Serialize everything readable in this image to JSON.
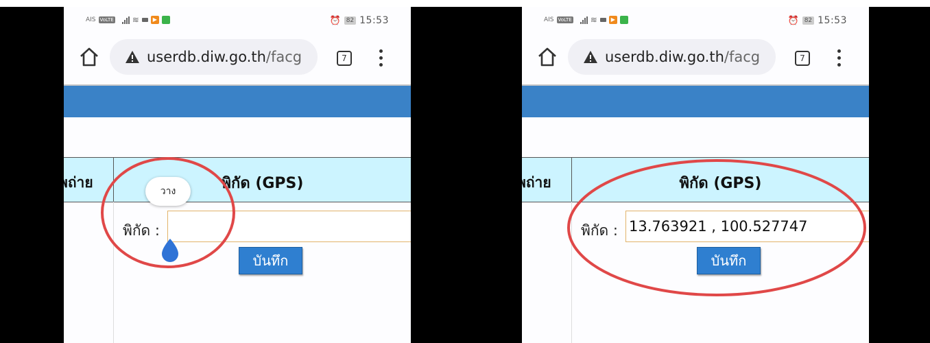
{
  "statusbar": {
    "carrier": "AIS",
    "volte": "VoLTE",
    "battery": "82",
    "time": "15:53"
  },
  "browser": {
    "url_main": "userdb.diw.go.th",
    "url_rest": "/facg",
    "tab_count": "7"
  },
  "table": {
    "col_left_header": "พถ่าย",
    "col_main_header": "พิกัด (GPS)"
  },
  "form": {
    "coord_label": "พิกัด :",
    "left_input_value": "",
    "right_input_value": "13.763921 , 100.527747",
    "save_label": "บันทึก"
  },
  "context_menu": {
    "paste_label": "วาง"
  },
  "colors": {
    "header_band": "#3a82c7",
    "table_header_bg": "#ccf4ff",
    "save_button": "#2f7fd0",
    "annotation_circle": "#e04848"
  }
}
